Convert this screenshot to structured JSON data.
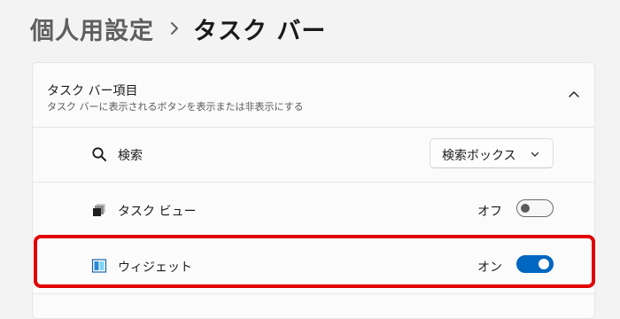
{
  "breadcrumb": {
    "parent": "個人用設定",
    "separator": "›",
    "current": "タスク バー"
  },
  "section": {
    "title": "タスク バー項目",
    "subtitle": "タスク バーに表示されるボタンを表示または非表示にする",
    "expanded": true
  },
  "rows": {
    "search": {
      "label": "検索",
      "icon": "search-icon",
      "dropdown_value": "検索ボックス"
    },
    "task_view": {
      "label": "タスク ビュー",
      "icon": "task-view-icon",
      "state_label": "オフ",
      "on": false
    },
    "widgets": {
      "label": "ウィジェット",
      "icon": "widgets-icon",
      "state_label": "オン",
      "on": true
    }
  },
  "colors": {
    "accent": "#0067c0",
    "highlight": "#e00000",
    "background": "#f3f3f3",
    "card": "#fbfbfb"
  }
}
